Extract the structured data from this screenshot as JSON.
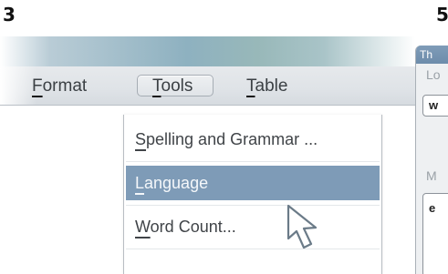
{
  "steps": {
    "left": "3",
    "right": "5"
  },
  "menubar": {
    "format": {
      "mnemonic": "F",
      "rest": "ormat"
    },
    "tools": {
      "mnemonic": "T",
      "rest": "ools"
    },
    "table": {
      "mnemonic": "T",
      "rest": "able"
    }
  },
  "tools_menu": {
    "items": [
      {
        "mnemonic": "S",
        "rest": "pelling  and  Grammar ..."
      },
      {
        "mnemonic": "L",
        "rest": "anguage",
        "highlighted": true
      },
      {
        "mnemonic": "W",
        "rest": "ord  Count..."
      }
    ]
  },
  "dialog": {
    "title": "Th",
    "label_1": "Lo",
    "field_1": "w",
    "label_2": "M",
    "field_2": "e"
  },
  "colors": {
    "highlight": "#7e9bb7",
    "dialog_title": "#7391af"
  },
  "icons": {
    "cursor": "mouse-pointer-icon"
  }
}
